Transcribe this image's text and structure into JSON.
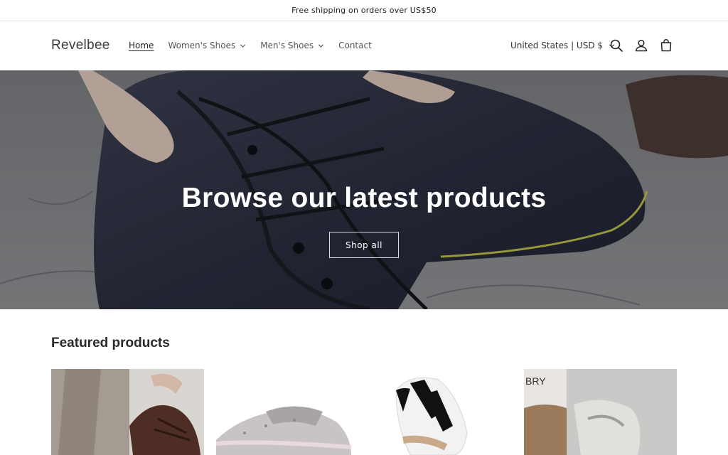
{
  "announcement": {
    "text": "Free shipping on orders over US$50"
  },
  "header": {
    "logo": "Revelbee",
    "nav": [
      {
        "label": "Home",
        "active": true,
        "dropdown": false
      },
      {
        "label": "Women's Shoes",
        "active": false,
        "dropdown": true
      },
      {
        "label": "Men's Shoes",
        "active": false,
        "dropdown": true
      },
      {
        "label": "Contact",
        "active": false,
        "dropdown": false
      }
    ],
    "country_selector": "United States | USD $",
    "icons": [
      "search-icon",
      "account-icon",
      "cart-icon"
    ]
  },
  "hero": {
    "title": "Browse our latest products",
    "button_label": "Shop all"
  },
  "featured": {
    "title": "Featured products",
    "products": [
      {
        "image": "brown-leather-sneaker-photo"
      },
      {
        "image": "glitter-silver-sneaker-photo"
      },
      {
        "image": "white-striped-sneaker-photo"
      },
      {
        "image": "grey-sneakers-box-photo"
      }
    ]
  },
  "colors": {
    "text": "#121212",
    "border": "#e6e6e6",
    "hero_text": "#ffffff"
  }
}
